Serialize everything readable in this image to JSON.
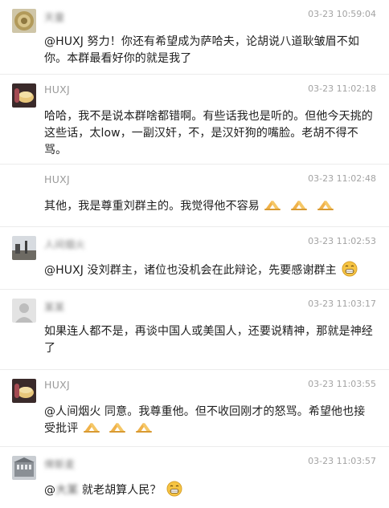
{
  "messages": [
    {
      "sender": "天童",
      "sender_blurred": true,
      "time": "03-23 10:59:04",
      "avatar": "round-gold-avatar",
      "text": "@HUXJ 努力！你还有希望成为萨哈夫，论胡说八道耿皱眉不如你。本群最看好你的就是我了"
    },
    {
      "sender": "HUXJ",
      "sender_blurred": false,
      "time": "03-23 11:02:18",
      "avatar": "cake-hand-avatar",
      "text": "哈哈，我不是说本群啥都错啊。有些话我也是听的。但他今天挑的这些话，太low，一副汉奸，不，是汉奸狗的嘴脸。老胡不得不骂。"
    },
    {
      "sender": "HUXJ",
      "sender_blurred": false,
      "time": "03-23 11:02:48",
      "avatar": "",
      "text": "其他，我是尊重刘群主的。我觉得他不容易",
      "emoji_after": "pray-emoji ×3"
    },
    {
      "sender": "人间烟火",
      "sender_blurred": true,
      "time": "03-23 11:02:53",
      "avatar": "landscape-avatar",
      "text": "@HUXJ 没刘群主，诸位也没机会在此辩论，先要感谢群主",
      "emoji_after": "grin-emoji"
    },
    {
      "sender": "某某",
      "sender_blurred": true,
      "time": "03-23 11:03:17",
      "avatar": "default-person-avatar",
      "text": "如果连人都不是，再谈中国人或美国人，还要说精神，那就是神经了"
    },
    {
      "sender": "HUXJ",
      "sender_blurred": false,
      "time": "03-23 11:03:55",
      "avatar": "cake-hand-avatar",
      "text_line1": "@人间烟火 同意。我尊重他。但不收回刚才的怒骂。希望他也接",
      "text_line2": "受批评",
      "emoji_after": "pray-emoji ×3"
    },
    {
      "sender": "俾斯麦",
      "sender_blurred": true,
      "time": "03-23 11:03:57",
      "avatar": "building-avatar",
      "text_prefix": "@",
      "text_blur": "大某",
      "text_suffix": " 就老胡算人民？",
      "emoji_after": "grin-emoji"
    }
  ],
  "colors": {
    "text": "#202020",
    "meta": "#a3a3a3",
    "sender": "#9a9a9a",
    "divider": "#ececec"
  }
}
